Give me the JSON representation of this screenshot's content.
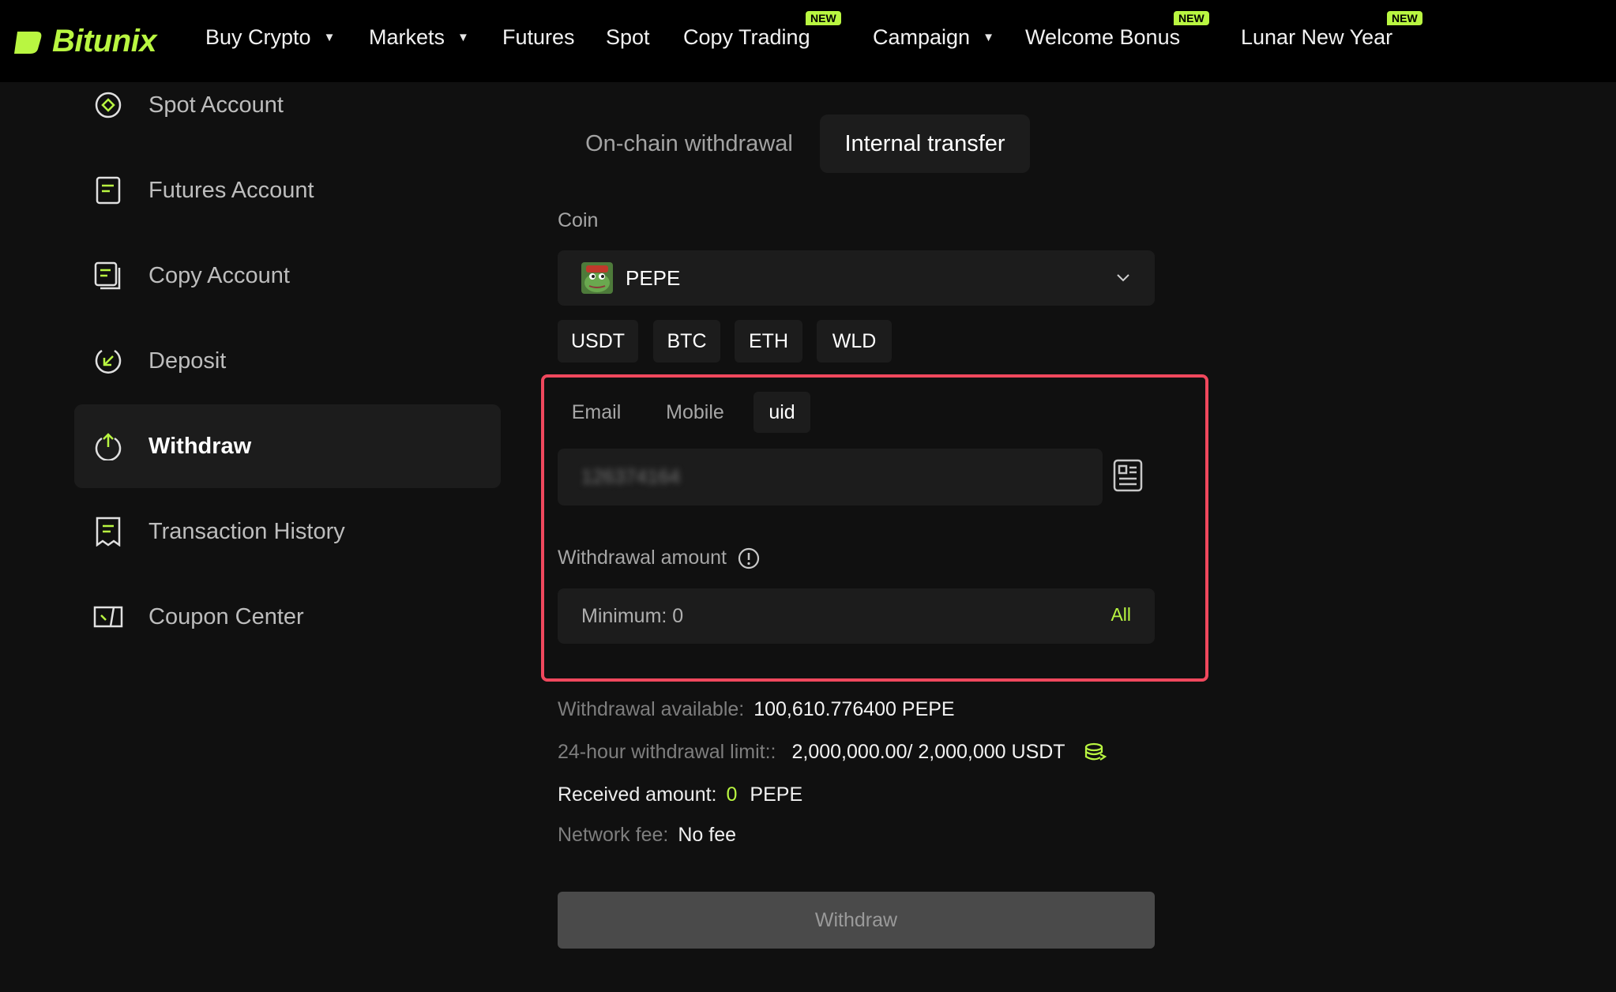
{
  "brand": {
    "name": "Bitunix",
    "accent": "#b9f641"
  },
  "nav": {
    "buy_crypto": "Buy Crypto",
    "markets": "Markets",
    "futures": "Futures",
    "spot": "Spot",
    "copy_trading": "Copy Trading",
    "campaign": "Campaign",
    "welcome_bonus": "Welcome Bonus",
    "lunar_new_year": "Lunar New Year",
    "new_badge": "NEW"
  },
  "sidebar": {
    "items": [
      {
        "label": "Spot Account",
        "icon": "target-icon"
      },
      {
        "label": "Futures Account",
        "icon": "document-icon"
      },
      {
        "label": "Copy Account",
        "icon": "copy-document-icon"
      },
      {
        "label": "Deposit",
        "icon": "deposit-icon"
      },
      {
        "label": "Withdraw",
        "icon": "withdraw-icon",
        "active": true
      },
      {
        "label": "Transaction History",
        "icon": "receipt-icon"
      },
      {
        "label": "Coupon Center",
        "icon": "coupon-icon"
      }
    ]
  },
  "tabs": {
    "onchain": "On-chain withdrawal",
    "internal": "Internal transfer",
    "active": "internal"
  },
  "coin": {
    "label": "Coin",
    "selected": "PEPE",
    "quick": [
      "USDT",
      "BTC",
      "ETH",
      "WLD"
    ]
  },
  "recipient": {
    "tabs": [
      "Email",
      "Mobile",
      "uid"
    ],
    "active": "uid",
    "value": "126374164"
  },
  "amount": {
    "label": "Withdrawal amount",
    "placeholder": "Minimum: 0",
    "all": "All"
  },
  "info": {
    "available_key": "Withdrawal available:",
    "available_val": "100,610.776400 PEPE",
    "limit_key": "24-hour withdrawal limit::",
    "limit_val": "2,000,000.00/ 2,000,000 USDT",
    "received_key": "Received amount:",
    "received_amount": "0",
    "received_unit": "PEPE",
    "fee_key": "Network fee:",
    "fee_val": "No fee"
  },
  "withdraw_button": "Withdraw"
}
